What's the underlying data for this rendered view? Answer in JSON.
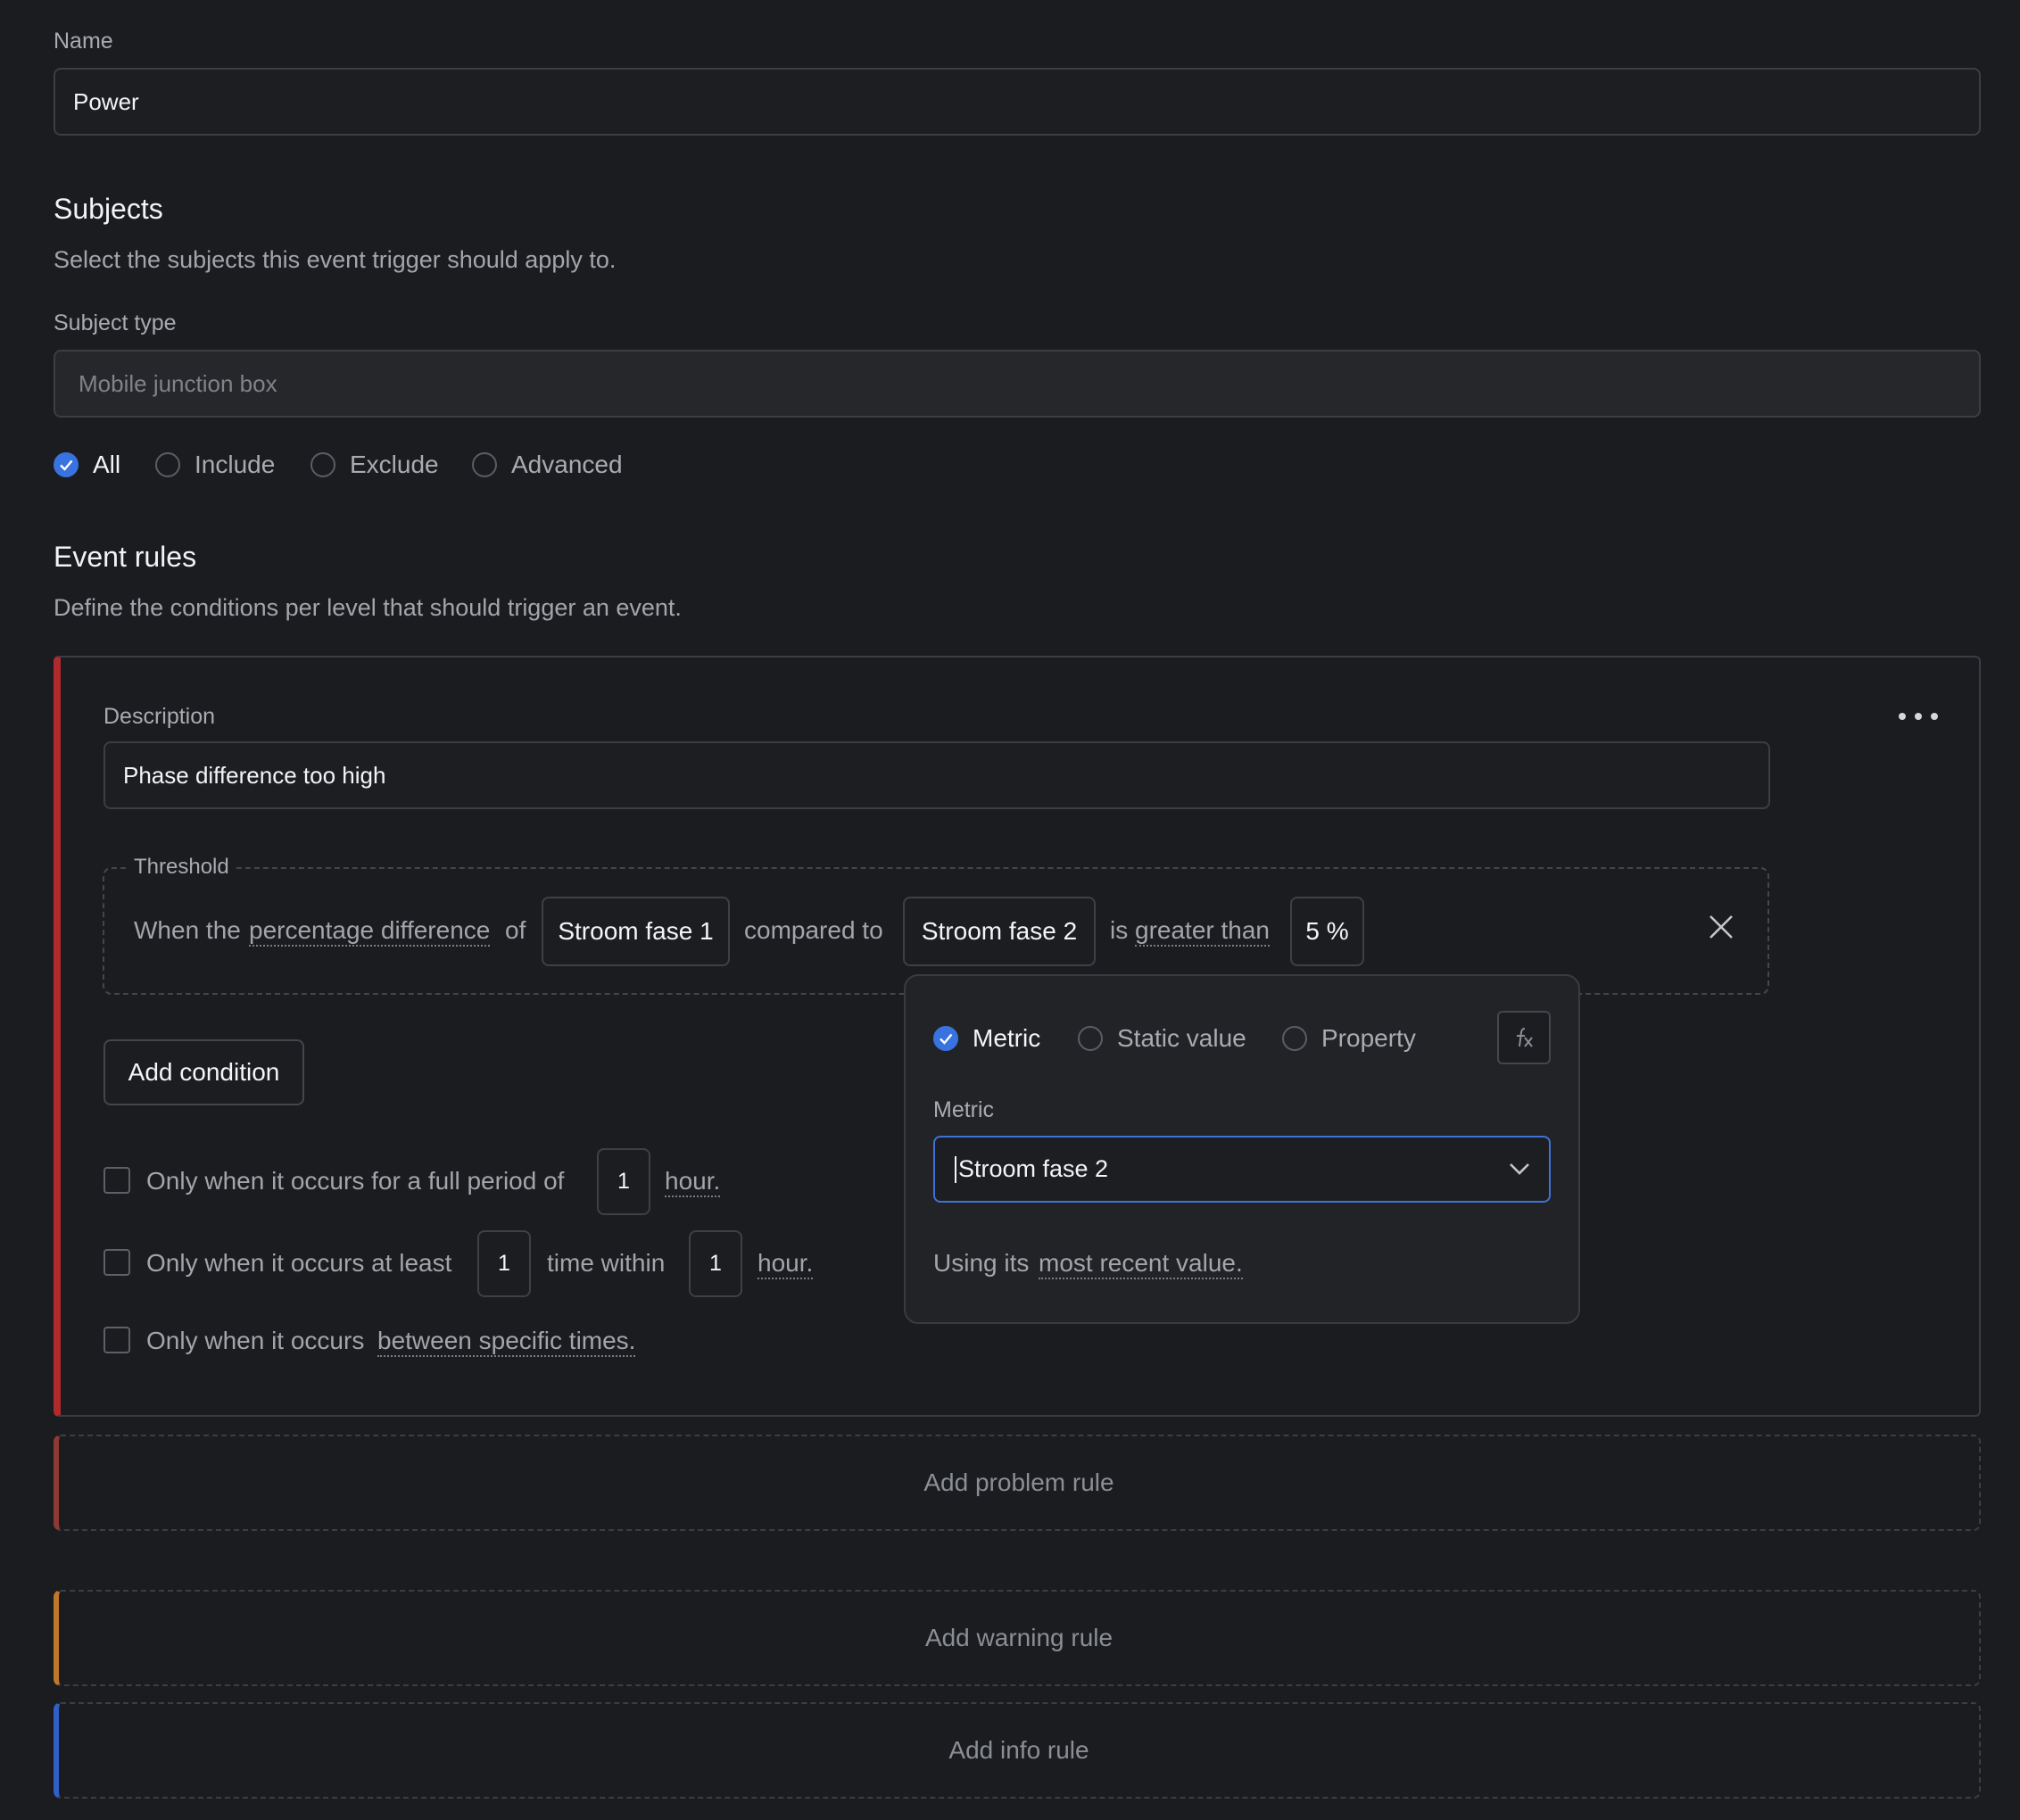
{
  "name": {
    "label": "Name",
    "value": "Power"
  },
  "subjects": {
    "title": "Subjects",
    "description": "Select the subjects this event trigger should apply to.",
    "subject_type_label": "Subject type",
    "subject_type_placeholder": "Mobile junction box",
    "options": [
      "All",
      "Include",
      "Exclude",
      "Advanced"
    ],
    "selected": "All"
  },
  "event_rules": {
    "title": "Event rules",
    "description": "Define the conditions per level that should trigger an event."
  },
  "rule": {
    "description_label": "Description",
    "description_value": "Phase difference too high",
    "threshold_legend": "Threshold",
    "sentence": {
      "prefix": "When the",
      "measure": "percentage difference",
      "of": "of",
      "metric1": "Stroom fase 1",
      "compared_to": "compared to",
      "metric2": "Stroom fase 2",
      "is": "is",
      "operator": "greater than",
      "value": "5 %"
    },
    "add_condition": "Add condition",
    "options": {
      "full_period": {
        "text": "Only when it occurs for a full period of",
        "value": "1",
        "unit": "hour."
      },
      "at_least": {
        "text": "Only when it occurs at least",
        "count": "1",
        "middle": "time within",
        "value": "1",
        "unit": "hour."
      },
      "between": {
        "text": "Only when it occurs",
        "link": "between specific times."
      }
    }
  },
  "popover": {
    "options": [
      "Metric",
      "Static value",
      "Property"
    ],
    "selected": "Metric",
    "metric_label": "Metric",
    "metric_value": "Stroom fase 2",
    "using_prefix": "Using its",
    "using_link": "most recent value."
  },
  "add_rules": {
    "problem": "Add problem rule",
    "warning": "Add warning rule",
    "info": "Add info rule"
  },
  "colors": {
    "problem": "#b02a2d",
    "problem_muted": "#8d3a34",
    "warning": "#c0772a",
    "info": "#2f5fc7",
    "accent": "#3973e0"
  }
}
